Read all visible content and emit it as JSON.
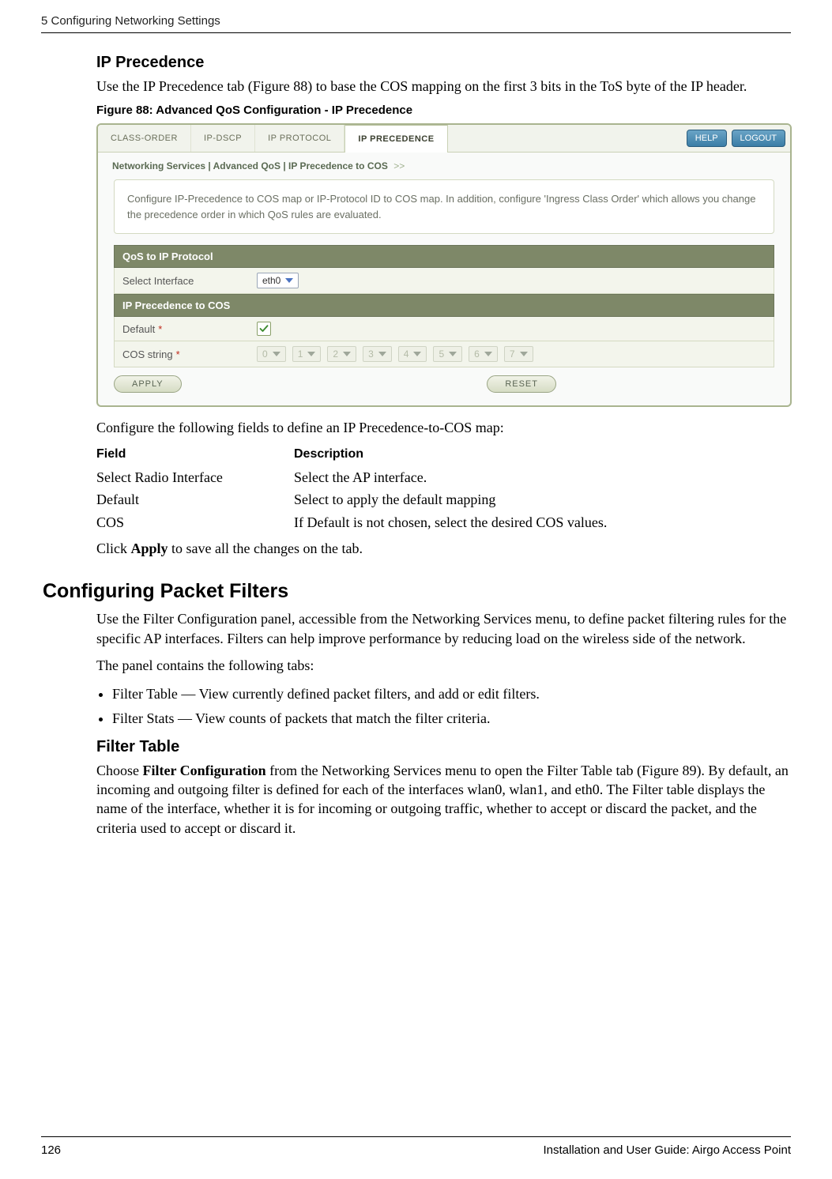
{
  "running_head": "5  Configuring Networking Settings",
  "ip_precedence": {
    "heading": "IP Precedence",
    "para": "Use the IP Precedence tab (Figure 88) to base the COS mapping on the first 3 bits in the ToS byte of the IP header.",
    "fig_caption": "Figure 88:      Advanced QoS Configuration - IP Precedence"
  },
  "panel": {
    "tabs": {
      "class_order": "CLASS-ORDER",
      "ip_dscp": "IP-DSCP",
      "ip_protocol": "IP PROTOCOL",
      "ip_precedence": "IP PRECEDENCE"
    },
    "help": "HELP",
    "logout": "LOGOUT",
    "breadcrumb": "Networking Services | Advanced QoS | IP Precedence to COS",
    "breadcrumb_sep": ">>",
    "info": "Configure IP-Precedence to COS map or IP-Protocol ID to COS map. In addition, configure 'Ingress Class Order' which allows you change the precedence order in which QoS rules are evaluated.",
    "section_qos": "QoS to IP Protocol",
    "select_interface_label": "Select Interface",
    "select_interface_value": "eth0",
    "section_ipp": "IP Precedence to COS",
    "default_label": "Default",
    "cos_label": "COS string",
    "cos_values": [
      "0",
      "1",
      "2",
      "3",
      "4",
      "5",
      "6",
      "7"
    ],
    "apply": "APPLY",
    "reset": "RESET"
  },
  "after_fig": {
    "para1": "Configure the following fields to define an IP Precedence-to-COS map:",
    "table": {
      "head_field": "Field",
      "head_desc": "Description",
      "rows": [
        {
          "f": "Select Radio Interface",
          "d": "Select the AP interface."
        },
        {
          "f": "Default",
          "d": "Select to apply the default mapping"
        },
        {
          "f": "COS",
          "d": "If Default is not chosen, select the desired COS values."
        }
      ]
    },
    "para2_pre": "Click ",
    "para2_b": "Apply",
    "para2_post": " to save all the changes on the tab."
  },
  "filters": {
    "heading": "Configuring Packet Filters",
    "para1": "Use the Filter Configuration panel, accessible from the Networking Services menu, to define packet filtering rules for the specific AP interfaces. Filters can help improve performance by reducing load on the wireless side of the network.",
    "para2": "The panel contains the following tabs:",
    "bullets": [
      "Filter Table — View currently defined packet filters, and add or edit filters.",
      "Filter Stats — View counts of packets that match the filter criteria."
    ],
    "filter_table_heading": "Filter Table",
    "ft_pre": "Choose ",
    "ft_b": "Filter Configuration",
    "ft_post": " from the Networking Services menu to open the Filter Table tab (Figure 89). By default, an incoming and outgoing filter is defined for each of the interfaces wlan0, wlan1, and eth0. The Filter table displays the name of the interface, whether it is for incoming or outgoing traffic, whether to accept or discard the packet, and the criteria used to accept or discard it."
  },
  "footer": {
    "page": "126",
    "title": "Installation and User Guide: Airgo Access Point"
  }
}
